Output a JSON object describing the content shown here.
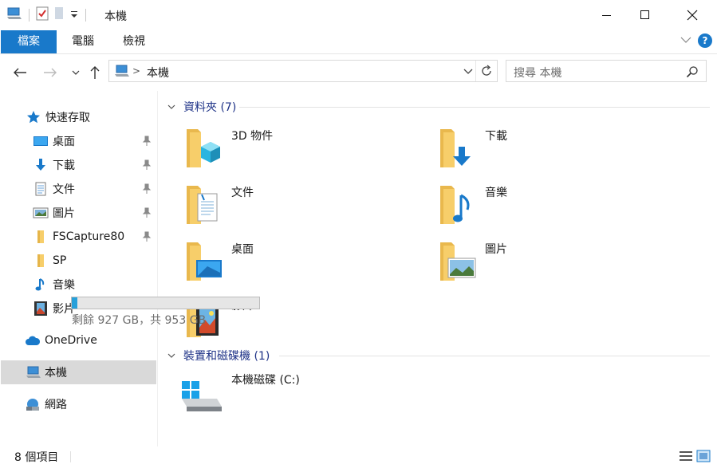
{
  "window": {
    "title": "本機",
    "colors": {
      "accent": "#1979ca",
      "folder": "#f7ce6a",
      "progress": "#26a0da"
    }
  },
  "ribbon": {
    "tabs": [
      {
        "label": "檔案"
      },
      {
        "label": "電腦"
      },
      {
        "label": "檢視"
      }
    ]
  },
  "address": {
    "path": "本機"
  },
  "search": {
    "placeholder": "搜尋 本機"
  },
  "sidebar": {
    "quick_access": "快速存取",
    "items": [
      {
        "label": "桌面",
        "icon": "desktop-icon",
        "pinned": true
      },
      {
        "label": "下載",
        "icon": "download-icon",
        "pinned": true
      },
      {
        "label": "文件",
        "icon": "document-icon",
        "pinned": true
      },
      {
        "label": "圖片",
        "icon": "picture-icon",
        "pinned": true
      },
      {
        "label": "FSCapture80",
        "icon": "folder-icon",
        "pinned": true
      },
      {
        "label": "SP",
        "icon": "folder-icon",
        "pinned": false
      },
      {
        "label": "音樂",
        "icon": "music-icon",
        "pinned": false
      },
      {
        "label": "影片",
        "icon": "video-icon",
        "pinned": false
      }
    ],
    "onedrive": "OneDrive",
    "this_pc": "本機",
    "network": "網路"
  },
  "content": {
    "folders_header": "資料夾 (7)",
    "folders": [
      {
        "name": "3D 物件",
        "icon": "3d-objects-icon"
      },
      {
        "name": "下載",
        "icon": "downloads-folder-icon"
      },
      {
        "name": "文件",
        "icon": "documents-folder-icon"
      },
      {
        "name": "音樂",
        "icon": "music-folder-icon"
      },
      {
        "name": "桌面",
        "icon": "desktop-folder-icon"
      },
      {
        "name": "圖片",
        "icon": "pictures-folder-icon"
      },
      {
        "name": "影片",
        "icon": "videos-folder-icon"
      }
    ],
    "devices_header": "裝置和磁碟機 (1)",
    "drive": {
      "name": "本機磁碟 (C:)",
      "free_text": "剩餘 927 GB，共 953 GB",
      "used_fraction": 0.028
    }
  },
  "status": {
    "item_count": "8 個項目"
  }
}
